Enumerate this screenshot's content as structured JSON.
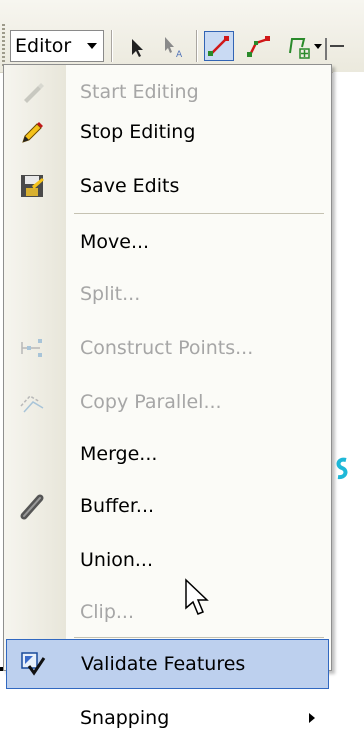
{
  "toolbar": {
    "editor_label": "Editor",
    "icons": [
      "edit-tool-icon",
      "sketch-annotation-icon",
      "straight-segment-icon",
      "line-segment-icon",
      "trace-polygon-icon"
    ]
  },
  "menu": {
    "items": [
      {
        "label": "Start Editing",
        "icon": "pencil-disabled-icon",
        "enabled": false
      },
      {
        "label": "Stop Editing",
        "icon": "pencil-icon",
        "enabled": true
      },
      {
        "label": "Save Edits",
        "icon": "save-icon",
        "enabled": true
      },
      {
        "label": "Move...",
        "icon": "",
        "enabled": true
      },
      {
        "label": "Split...",
        "icon": "",
        "enabled": false
      },
      {
        "label": "Construct Points...",
        "icon": "construct-points-icon",
        "enabled": false
      },
      {
        "label": "Copy Parallel...",
        "icon": "copy-parallel-icon",
        "enabled": false
      },
      {
        "label": "Merge...",
        "icon": "",
        "enabled": true
      },
      {
        "label": "Buffer...",
        "icon": "buffer-icon",
        "enabled": true
      },
      {
        "label": "Union...",
        "icon": "",
        "enabled": true
      },
      {
        "label": "Clip...",
        "icon": "",
        "enabled": false
      },
      {
        "label": "Validate Features",
        "icon": "validate-features-icon",
        "enabled": true,
        "highlighted": true
      },
      {
        "label": "Snapping",
        "icon": "",
        "enabled": true,
        "submenu": true
      }
    ]
  },
  "colors": {
    "highlight_bg": "#bdd0ee",
    "highlight_border": "#3168c0",
    "disabled_text": "#a6a6a6",
    "accent_red": "#d01818",
    "accent_green": "#2a8a2a"
  }
}
